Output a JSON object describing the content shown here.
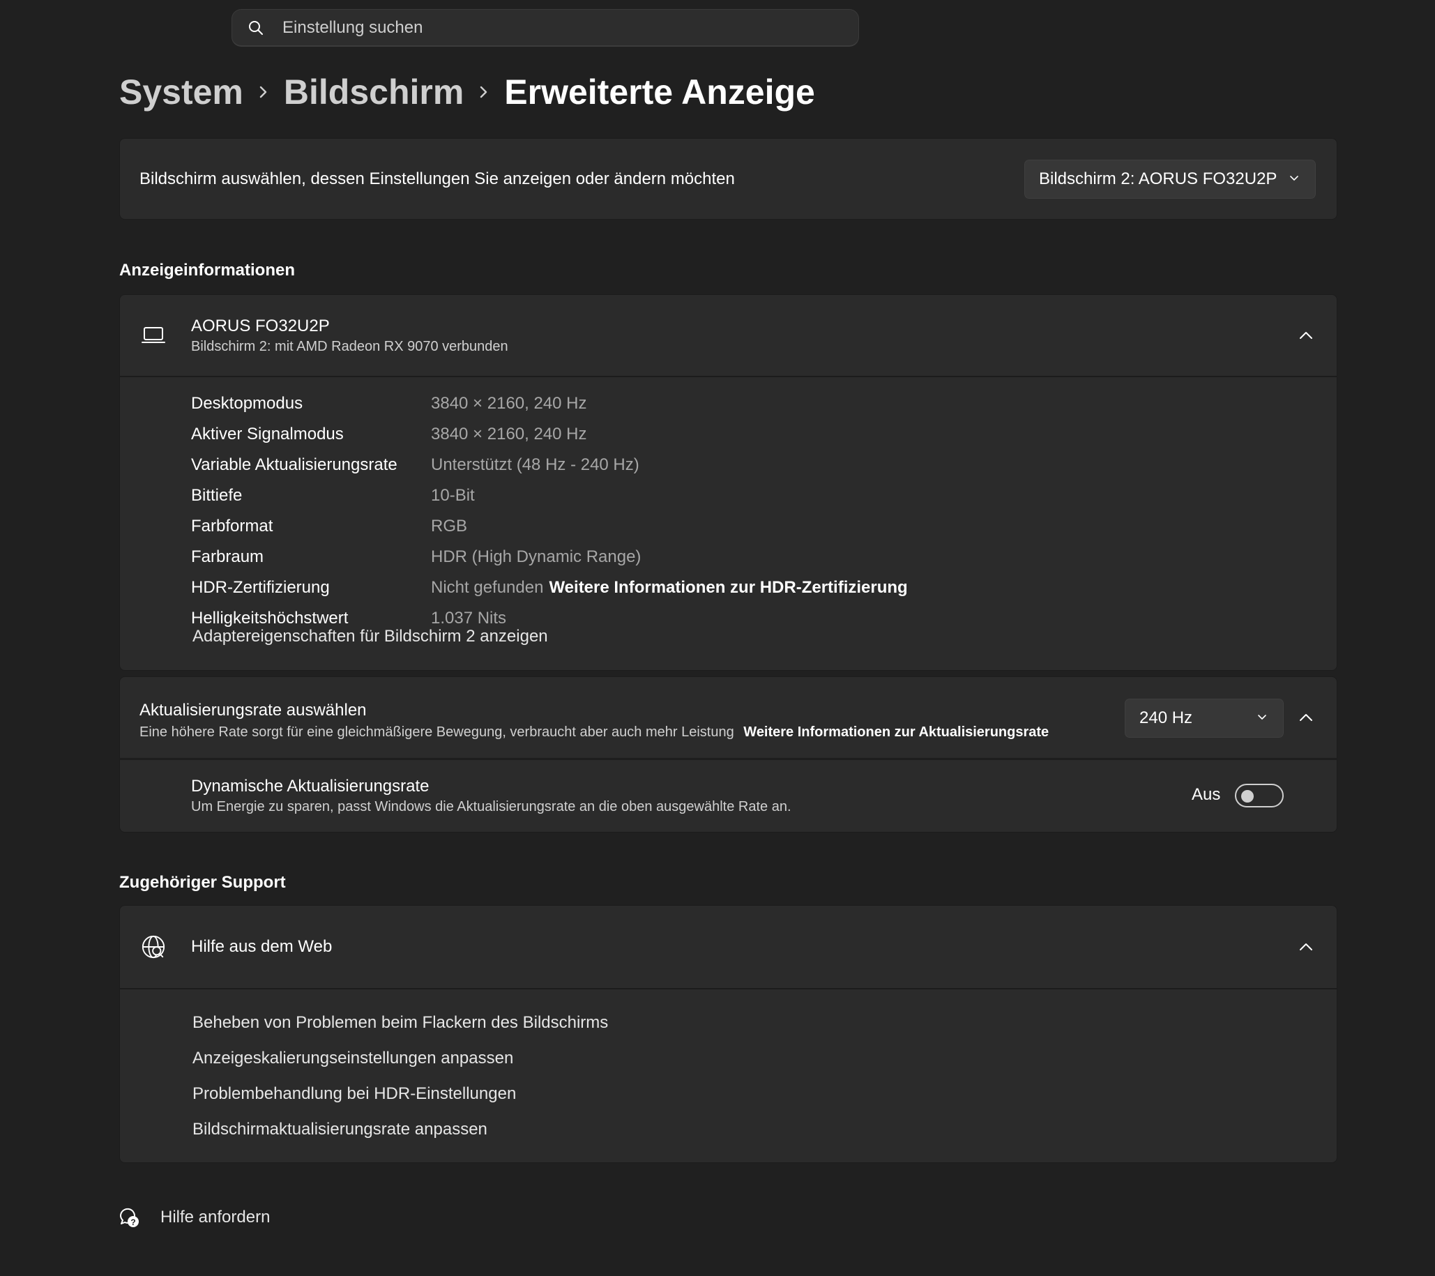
{
  "search": {
    "placeholder": "Einstellung suchen"
  },
  "breadcrumb": {
    "items": [
      "System",
      "Bildschirm"
    ],
    "current": "Erweiterte Anzeige"
  },
  "display_select": {
    "label": "Bildschirm auswählen, dessen Einstellungen Sie anzeigen oder ändern möchten",
    "selected": "Bildschirm 2: AORUS FO32U2P"
  },
  "display_info": {
    "section_title": "Anzeigeinformationen",
    "monitor_name": "AORUS FO32U2P",
    "monitor_sub": "Bildschirm 2: mit AMD Radeon RX 9070 verbunden",
    "rows": [
      {
        "key": "Desktopmodus",
        "value": "3840 × 2160, 240 Hz"
      },
      {
        "key": "Aktiver Signalmodus",
        "value": "3840 × 2160, 240 Hz"
      },
      {
        "key": "Variable Aktualisierungsrate",
        "value": "Unterstützt (48 Hz - 240 Hz)"
      },
      {
        "key": "Bittiefe",
        "value": "10-Bit"
      },
      {
        "key": "Farbformat",
        "value": "RGB"
      },
      {
        "key": "Farbraum",
        "value": "HDR (High Dynamic Range)"
      },
      {
        "key": "HDR-Zertifizierung",
        "value": "Nicht gefunden",
        "link": "Weitere Informationen zur HDR-Zertifizierung"
      },
      {
        "key": "Helligkeitshöchstwert",
        "value": "1.037 Nits"
      }
    ],
    "adapter_link": "Adaptereigenschaften für Bildschirm 2 anzeigen"
  },
  "refresh_rate": {
    "title": "Aktualisierungsrate auswählen",
    "subtitle": "Eine höhere Rate sorgt für eine gleichmäßigere Bewegung, verbraucht aber auch mehr Leistung",
    "link": "Weitere Informationen zur Aktualisierungsrate",
    "selected": "240 Hz",
    "dynamic": {
      "title": "Dynamische Aktualisierungsrate",
      "subtitle": "Um Energie zu sparen, passt Windows die Aktualisierungsrate an die oben ausgewählte Rate an.",
      "state_label": "Aus",
      "enabled": false
    }
  },
  "support": {
    "section_title": "Zugehöriger Support",
    "web_help_title": "Hilfe aus dem Web",
    "links": [
      "Beheben von Problemen beim Flackern des Bildschirms",
      "Anzeigeskalierungseinstellungen anpassen",
      "Problembehandlung bei HDR-Einstellungen",
      "Bildschirmaktualisierungsrate anpassen"
    ]
  },
  "help_request": {
    "label": "Hilfe anfordern"
  },
  "icons": {
    "search": "search-icon",
    "chevron_right": "chevron-right-icon",
    "chevron_down": "chevron-down-icon",
    "chevron_up": "chevron-up-icon",
    "monitor": "laptop-icon",
    "web": "globe-icon",
    "help": "help-chat-icon"
  },
  "colors": {
    "background": "#202020",
    "card": "#2b2b2b",
    "text_primary": "#ffffff",
    "text_secondary": "#a7a7a7"
  }
}
